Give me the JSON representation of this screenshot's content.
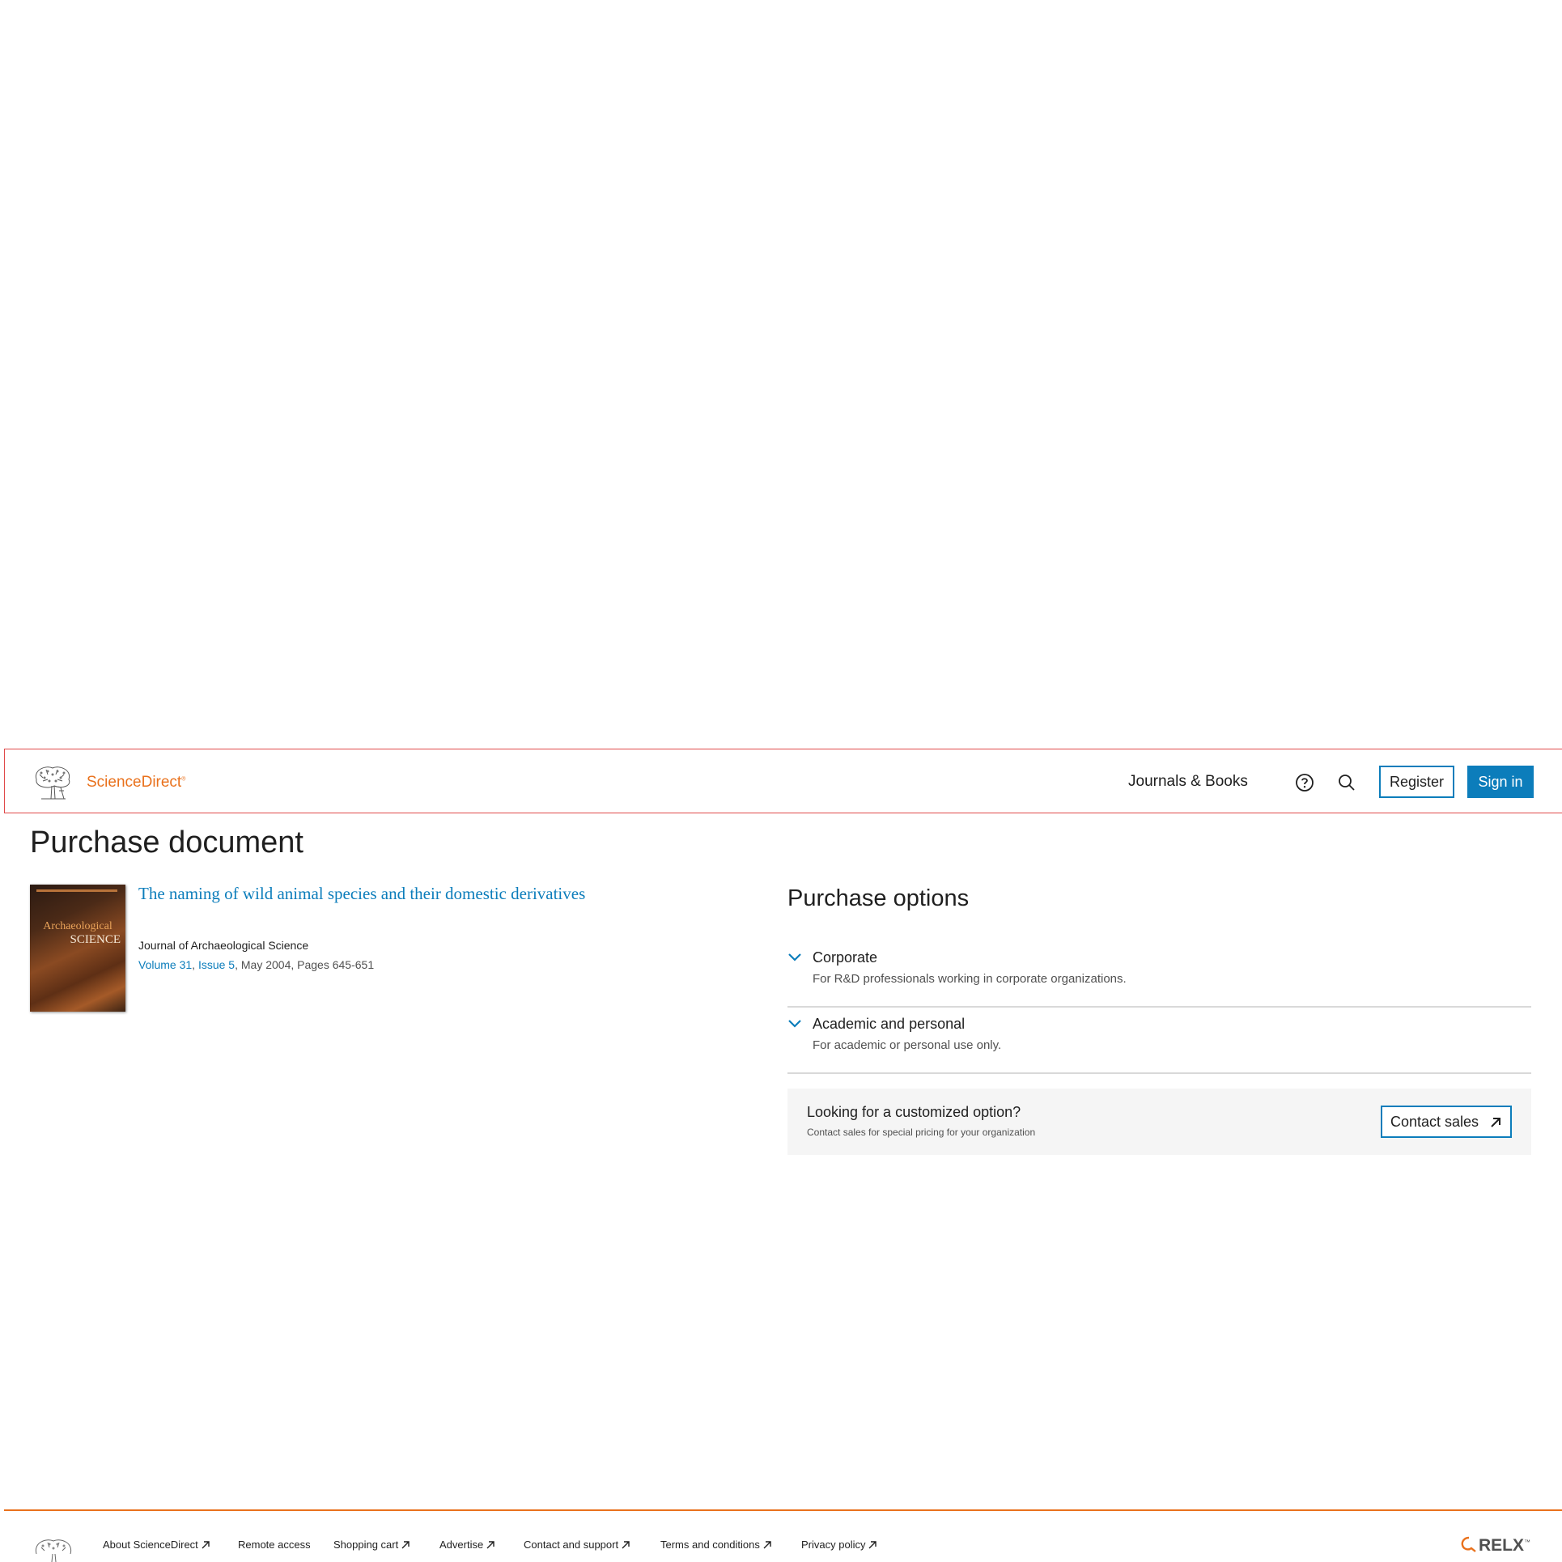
{
  "header": {
    "brand": "ScienceDirect",
    "brand_mark": "®",
    "nav_journals": "Journals & Books",
    "register_label": "Register",
    "signin_label": "Sign in"
  },
  "page": {
    "title": "Purchase document"
  },
  "article": {
    "title": "The naming of wild animal species and their domestic derivatives",
    "journal": "Journal of Archaeological Science",
    "volume": "Volume 31",
    "issue": "Issue 5",
    "date_pages": ", May 2004, Pages 645-651",
    "separator": ", ",
    "cover": {
      "journal_text": "Archaeological",
      "science_text": "SCIENCE"
    }
  },
  "purchase": {
    "title": "Purchase options",
    "options": [
      {
        "label": "Corporate",
        "desc": "For R&D professionals working in corporate organizations."
      },
      {
        "label": "Academic and personal",
        "desc": "For academic or personal use only."
      }
    ],
    "custom": {
      "title": "Looking for a customized option?",
      "subtitle": "Contact sales for special pricing for your organization",
      "button": "Contact sales"
    }
  },
  "footer": {
    "links": [
      "About ScienceDirect",
      "Remote access",
      "Shopping cart",
      "Advertise",
      "Contact and support",
      "Terms and conditions",
      "Privacy policy"
    ],
    "relx": "RELX",
    "relx_mark": "™"
  },
  "colors": {
    "accent": "#0c7dbb",
    "brand": "#e9711c",
    "header_border": "#e04848"
  }
}
